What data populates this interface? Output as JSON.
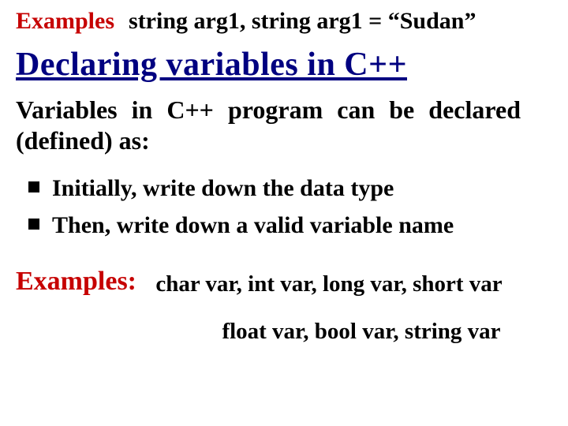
{
  "line1": {
    "label": "Examples",
    "code": "string  arg1, string arg1 = “Sudan”"
  },
  "heading": "Declaring variables in C++",
  "paragraph": "Variables in C++ program can be declared (defined) as:",
  "bullets": [
    "Initially, write down the data type",
    "Then, write down a valid variable name"
  ],
  "examples2": {
    "label": "Examples:",
    "body": "char  var, int var, long var, short var"
  },
  "examples3": "float var, bool var, string var"
}
